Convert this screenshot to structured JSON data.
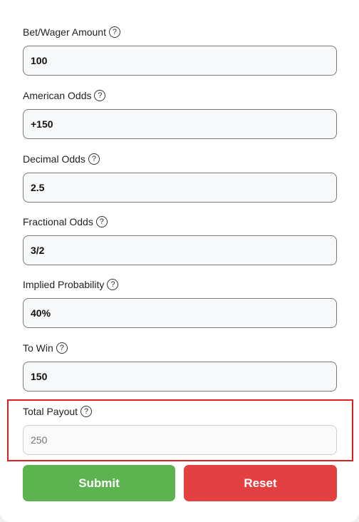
{
  "fields": [
    {
      "label": "Bet/Wager Amount",
      "value": "100"
    },
    {
      "label": "American Odds",
      "value": "+150"
    },
    {
      "label": "Decimal Odds",
      "value": "2.5"
    },
    {
      "label": "Fractional Odds",
      "value": "3/2"
    },
    {
      "label": "Implied Probability",
      "value": "40%"
    },
    {
      "label": "To Win",
      "value": "150"
    }
  ],
  "total_payout": {
    "label": "Total Payout",
    "placeholder": "250"
  },
  "help_glyph": "?",
  "buttons": {
    "submit_label": "Submit",
    "reset_label": "Reset"
  },
  "colors": {
    "submit": "#5cb350",
    "reset": "#e34041",
    "highlight": "#e02020"
  }
}
